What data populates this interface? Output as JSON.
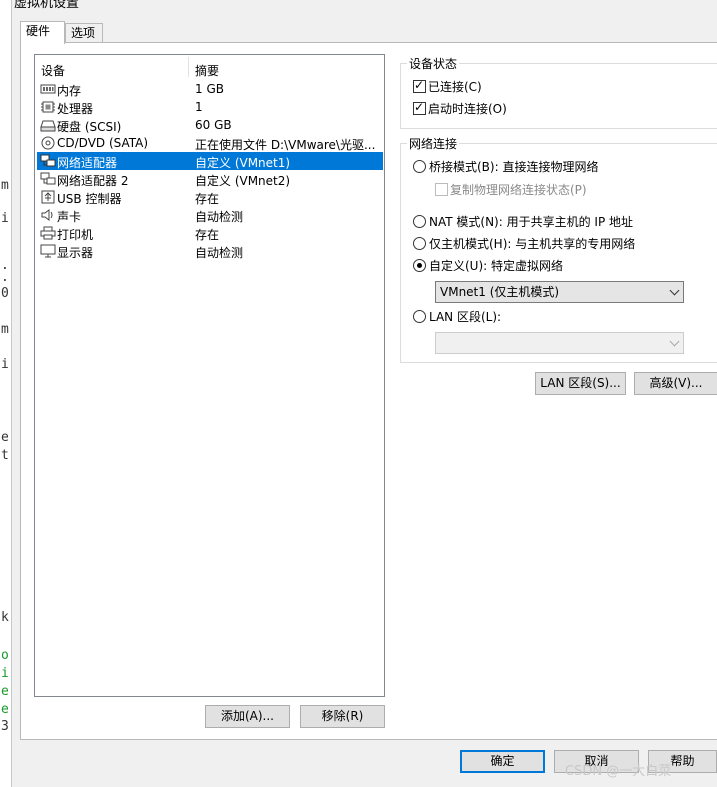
{
  "window": {
    "title": "虚拟机设置"
  },
  "tabs": [
    {
      "label": "硬件"
    },
    {
      "label": "选项"
    }
  ],
  "device_list": {
    "columns": {
      "device": "设备",
      "summary": "摘要"
    },
    "rows": [
      {
        "name": "内存",
        "summary": "1 GB",
        "icon": "memory-icon"
      },
      {
        "name": "处理器",
        "summary": "1",
        "icon": "processor-icon"
      },
      {
        "name": "硬盘 (SCSI)",
        "summary": "60 GB",
        "icon": "hard-disk-icon"
      },
      {
        "name": "CD/DVD (SATA)",
        "summary": "正在使用文件 D:\\VMware\\光驱...",
        "icon": "cd-dvd-icon"
      },
      {
        "name": "网络适配器",
        "summary": "自定义 (VMnet1)",
        "icon": "network-adapter-icon",
        "selected": true
      },
      {
        "name": "网络适配器 2",
        "summary": "自定义 (VMnet2)",
        "icon": "network-adapter-icon"
      },
      {
        "name": "USB 控制器",
        "summary": "存在",
        "icon": "usb-icon"
      },
      {
        "name": "声卡",
        "summary": "自动检测",
        "icon": "sound-card-icon"
      },
      {
        "name": "打印机",
        "summary": "存在",
        "icon": "printer-icon"
      },
      {
        "name": "显示器",
        "summary": "自动检测",
        "icon": "display-icon"
      }
    ],
    "add_label": "添加(A)...",
    "remove_label": "移除(R)"
  },
  "device_status": {
    "title": "设备状态",
    "connected_label": "已连接(C)",
    "connected_checked": true,
    "connect_on_poweron_label": "启动时连接(O)",
    "connect_on_poweron_checked": true
  },
  "network": {
    "title": "网络连接",
    "bridged_label": "桥接模式(B): 直接连接物理网络",
    "replicate_label": "复制物理网络连接状态(P)",
    "nat_label": "NAT 模式(N): 用于共享主机的 IP 地址",
    "hostonly_label": "仅主机模式(H): 与主机共享的专用网络",
    "custom_label": "自定义(U): 特定虚拟网络",
    "custom_selected_value": "VMnet1 (仅主机模式)",
    "lan_label": "LAN 区段(L):",
    "lan_value": "",
    "selected_mode": "custom"
  },
  "right_buttons": {
    "lan_segments_label": "LAN 区段(S)...",
    "advanced_label": "高级(V)..."
  },
  "footer": {
    "ok_label": "确定",
    "cancel_label": "取消",
    "help_label": "帮助"
  },
  "watermark": "CSDN @一大白菜",
  "background_text": [
    {
      "text": "m"
    },
    {
      "text": "i"
    },
    {
      "text": "."
    },
    {
      "text": "."
    },
    {
      "text": "0"
    },
    {
      "text": "m"
    },
    {
      "text": "i"
    },
    {
      "text": "e"
    },
    {
      "text": "t"
    },
    {
      "text": "k"
    },
    {
      "text": "o"
    },
    {
      "text": "i"
    },
    {
      "text": "e"
    },
    {
      "text": "e"
    },
    {
      "text": "3"
    }
  ]
}
